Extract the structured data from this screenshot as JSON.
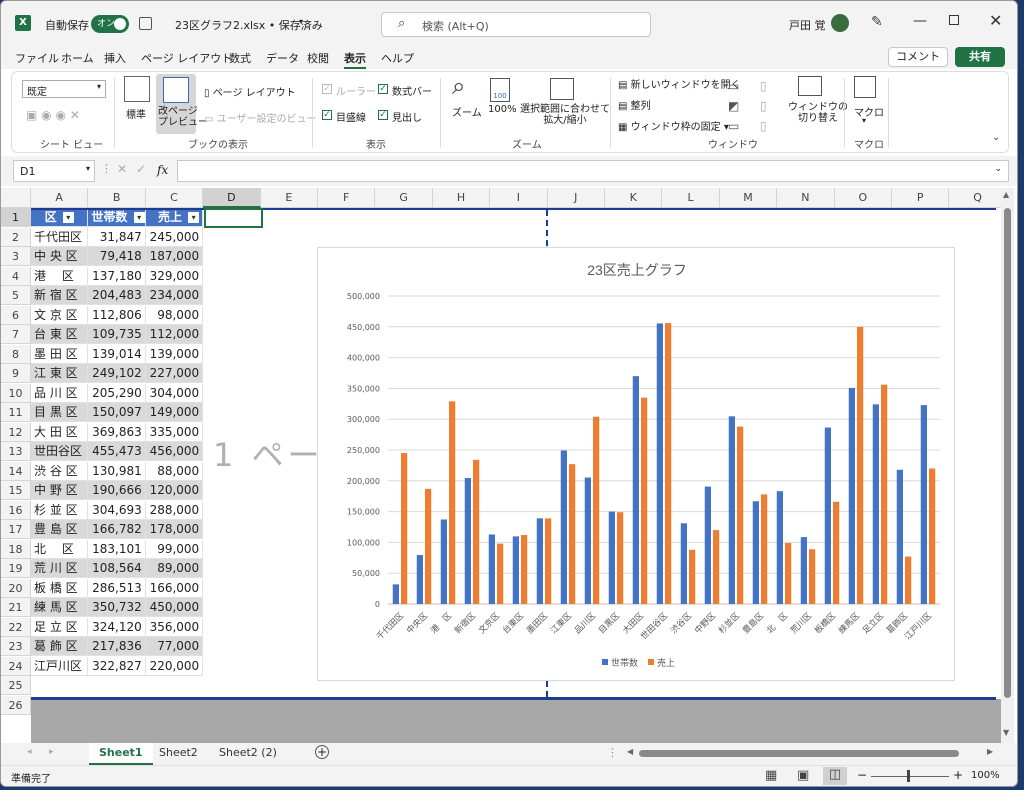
{
  "titlebar": {
    "autosave_label": "自動保存",
    "autosave_state": "オン",
    "file_title": "23区グラフ2.xlsx • 保存済み",
    "search_placeholder": "検索 (Alt+Q)",
    "user_name": "戸田 覚"
  },
  "menu": [
    "ファイル",
    "ホーム",
    "挿入",
    "ページ レイアウト",
    "数式",
    "データ",
    "校閲",
    "表示",
    "ヘルプ"
  ],
  "menu_active": "表示",
  "actions": {
    "comment": "コメント",
    "share": "共有"
  },
  "ribbon": {
    "sheetview": {
      "dropdown": "既定",
      "label": "シート ビュー"
    },
    "bookview": {
      "normal": "標準",
      "pagebreak": "改ページ\nプレビュー",
      "pagelayout": "ページ レイアウト",
      "custom": "ユーザー設定のビュー",
      "label": "ブックの表示"
    },
    "show": {
      "ruler": "ルーラー",
      "formulabar": "数式バー",
      "gridlines": "目盛線",
      "headings": "見出し",
      "label": "表示"
    },
    "zoom": {
      "zoom": "ズーム",
      "hundred": "100%",
      "selection": "選択範囲に合わせて\n拡大/縮小",
      "label": "ズーム"
    },
    "window": {
      "newwin": "新しいウィンドウを開く",
      "arrange": "整列",
      "freeze": "ウィンドウ枠の固定",
      "switch": "ウィンドウの\n切り替え",
      "label": "ウィンドウ"
    },
    "macro": {
      "macro": "マクロ",
      "label": "マクロ"
    }
  },
  "formula": {
    "namebox": "D1",
    "fx": "fx"
  },
  "columns": [
    "A",
    "B",
    "C",
    "D",
    "E",
    "F",
    "G",
    "H",
    "I",
    "J",
    "K",
    "L",
    "M",
    "N",
    "O",
    "P",
    "Q"
  ],
  "table": {
    "headers": [
      "区",
      "世帯数",
      "売上"
    ],
    "rows": [
      [
        "千代田区",
        "31,847",
        "245,000"
      ],
      [
        "中 央 区",
        "79,418",
        "187,000"
      ],
      [
        "港　 区",
        "137,180",
        "329,000"
      ],
      [
        "新 宿 区",
        "204,483",
        "234,000"
      ],
      [
        "文 京 区",
        "112,806",
        "98,000"
      ],
      [
        "台 東 区",
        "109,735",
        "112,000"
      ],
      [
        "墨 田 区",
        "139,014",
        "139,000"
      ],
      [
        "江 東 区",
        "249,102",
        "227,000"
      ],
      [
        "品 川 区",
        "205,290",
        "304,000"
      ],
      [
        "目 黒 区",
        "150,097",
        "149,000"
      ],
      [
        "大 田 区",
        "369,863",
        "335,000"
      ],
      [
        "世田谷区",
        "455,473",
        "456,000"
      ],
      [
        "渋 谷 区",
        "130,981",
        "88,000"
      ],
      [
        "中 野 区",
        "190,666",
        "120,000"
      ],
      [
        "杉 並 区",
        "304,693",
        "288,000"
      ],
      [
        "豊 島 区",
        "166,782",
        "178,000"
      ],
      [
        "北　 区",
        "183,101",
        "99,000"
      ],
      [
        "荒 川 区",
        "108,564",
        "89,000"
      ],
      [
        "板 橋 区",
        "286,513",
        "166,000"
      ],
      [
        "練 馬 区",
        "350,732",
        "450,000"
      ],
      [
        "足 立 区",
        "324,120",
        "356,000"
      ],
      [
        "葛 飾 区",
        "217,836",
        "77,000"
      ],
      [
        "江戸川区",
        "322,827",
        "220,000"
      ]
    ]
  },
  "page_watermark": "1 ペー",
  "chart_data": {
    "type": "bar",
    "title": "23区売上グラフ",
    "categories": [
      "千代田区",
      "中央区",
      "港　区",
      "新宿区",
      "文京区",
      "台東区",
      "墨田区",
      "江東区",
      "品川区",
      "目黒区",
      "大田区",
      "世田谷区",
      "渋谷区",
      "中野区",
      "杉並区",
      "豊島区",
      "北　区",
      "荒川区",
      "板橋区",
      "練馬区",
      "足立区",
      "葛飾区",
      "江戸川区"
    ],
    "series": [
      {
        "name": "世帯数",
        "color": "#4472c4",
        "values": [
          31847,
          79418,
          137180,
          204483,
          112806,
          109735,
          139014,
          249102,
          205290,
          150097,
          369863,
          455473,
          130981,
          190666,
          304693,
          166782,
          183101,
          108564,
          286513,
          350732,
          324120,
          217836,
          322827
        ]
      },
      {
        "name": "売上",
        "color": "#ed7d31",
        "values": [
          245000,
          187000,
          329000,
          234000,
          98000,
          112000,
          139000,
          227000,
          304000,
          149000,
          335000,
          456000,
          88000,
          120000,
          288000,
          178000,
          99000,
          89000,
          166000,
          450000,
          356000,
          77000,
          220000
        ]
      }
    ],
    "ylim": [
      0,
      500000
    ],
    "yticks": [
      "0",
      "50,000",
      "100,000",
      "150,000",
      "200,000",
      "250,000",
      "300,000",
      "350,000",
      "400,000",
      "450,000",
      "500,000"
    ],
    "grid": true,
    "legend": "bottom"
  },
  "sheets": [
    "Sheet1",
    "Sheet2",
    "Sheet2 (2)"
  ],
  "active_sheet": "Sheet1",
  "status": {
    "ready": "準備完了",
    "zoom": "100%"
  }
}
